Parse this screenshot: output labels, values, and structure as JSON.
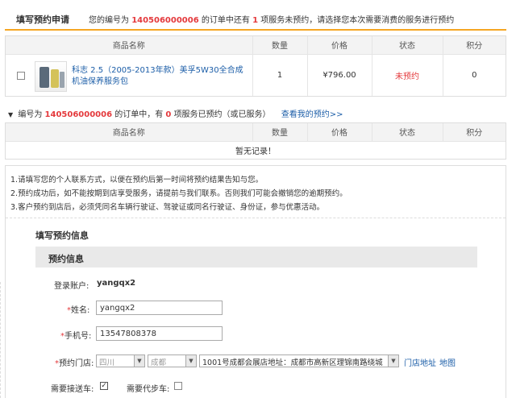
{
  "header": {
    "title": "填写预约申请",
    "msg_prefix": "您的编号为",
    "order_number": "140506000006",
    "msg_mid": "的订单中还有",
    "remaining_count": "1",
    "msg_suffix": "项服务未预约，请选择您本次需要消费的服务进行预约"
  },
  "table_columns": [
    "商品名称",
    "数量",
    "价格",
    "状态",
    "积分"
  ],
  "pending_items": [
    {
      "name": "科志 2.5（2005-2013年款）美孚5W30全合成机油保养服务包",
      "quantity": "1",
      "price": "¥796.00",
      "status": "未预约",
      "points": "0",
      "checked": false
    }
  ],
  "booked_section": {
    "prefix": "编号为",
    "order_number": "140506000006",
    "mid": "的订单中，有",
    "count": "0",
    "suffix": "项服务已预约（或已服务）",
    "link": "查看我的预约>>",
    "empty_text": "暂无记录！"
  },
  "notes": [
    "1.请填写您的个人联系方式，以便在预约后第一时间将预约结果告知与您。",
    "2.预约成功后，如不能按期到店享受服务，请提前与我们联系。否则我们可能会撤销您的逾期预约。",
    "3.客户预约到店后，必须凭同名车辆行驶证、驾驶证或同名行驶证、身份证，参与优惠活动。"
  ],
  "form": {
    "section_title": "填写预约信息",
    "panel_title": "预约信息",
    "account_label": "登录账户:",
    "account_value": "yangqx2",
    "name_label": "姓名:",
    "name_value": "yangqx2",
    "phone_label": "手机号:",
    "phone_value": "13547808378",
    "store_label": "预约门店:",
    "province": "四川",
    "city": "成都",
    "store": "1001号成都会展店地址：成都市高新区理锦南路绕城",
    "store_address_link": "门店地址",
    "map_link": "地图",
    "pickup_label": "需要接送车:",
    "pickup_checked": true,
    "substitute_label": "需要代步车:",
    "substitute_checked": false
  }
}
